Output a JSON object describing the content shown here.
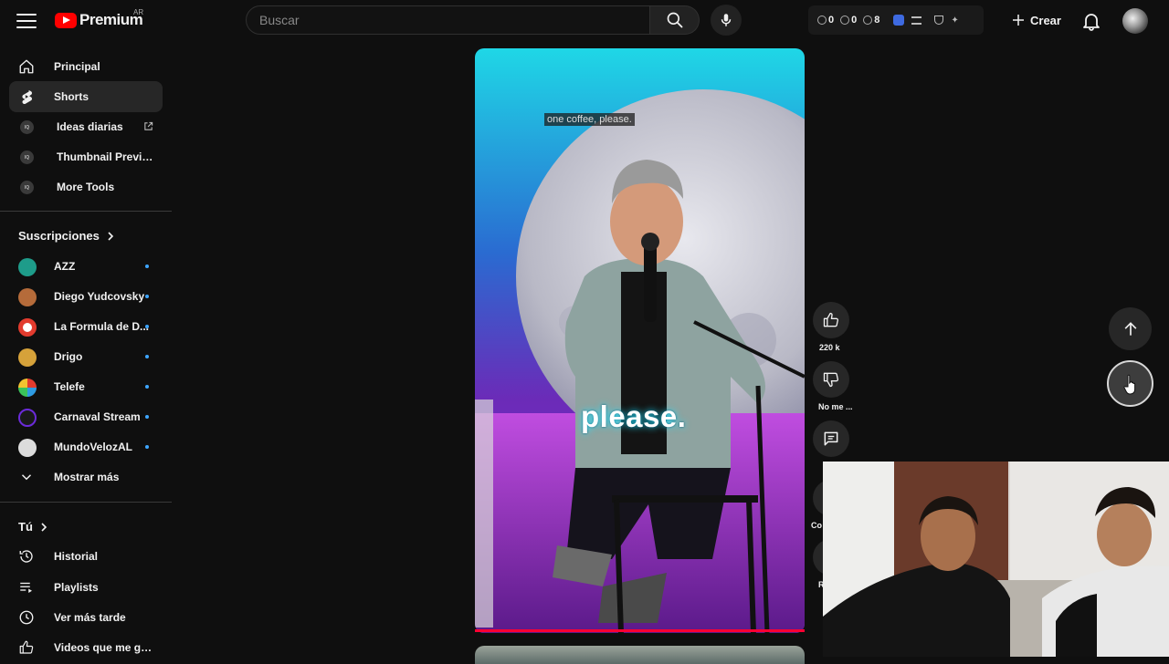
{
  "header": {
    "logo_text": "Premium",
    "region": "AR",
    "search_placeholder": "Buscar",
    "ext_stats": [
      "0",
      "0",
      "8"
    ],
    "create_label": "Crear"
  },
  "sidebar": {
    "main_items": [
      {
        "label": "Principal",
        "icon": "home-icon"
      },
      {
        "label": "Shorts",
        "icon": "shorts-icon",
        "active": true
      },
      {
        "label": "Ideas diarias",
        "icon": "iq-icon"
      },
      {
        "label": "Thumbnail Preview",
        "icon": "iq-icon"
      },
      {
        "label": "More Tools",
        "icon": "iq-icon"
      }
    ],
    "subs_title": "Suscripciones",
    "subs": [
      {
        "name": "AZZ",
        "color": "#1e9c8a"
      },
      {
        "name": "Diego Yudcovsky",
        "color": "#b56b3a"
      },
      {
        "name": "La Formula de D...",
        "color": "#e23b2e"
      },
      {
        "name": "Drigo",
        "color": "#d6a23a"
      },
      {
        "name": "Telefe",
        "color": "#e0e0e0"
      },
      {
        "name": "Carnaval Stream",
        "color": "#6b2bd9"
      },
      {
        "name": "MundoVelozAL",
        "color": "#dcdcdc"
      }
    ],
    "show_more": "Mostrar más",
    "you_title": "Tú",
    "you_items": [
      {
        "label": "Historial",
        "icon": "history-icon"
      },
      {
        "label": "Playlists",
        "icon": "playlists-icon"
      },
      {
        "label": "Ver más tarde",
        "icon": "clock-icon"
      },
      {
        "label": "Videos que me gus...",
        "icon": "thumb-up-icon"
      }
    ]
  },
  "video": {
    "caption_small": "one coffee, please.",
    "caption_big": "please."
  },
  "actions": {
    "like_count": "220 k",
    "dislike_label": "No me ...",
    "comments_label_partial": "Co",
    "share_label_partial": "R"
  },
  "colors": {
    "background": "#0f0f0f",
    "accent_red": "#ff0000",
    "notification_dot": "#3ea6ff"
  }
}
